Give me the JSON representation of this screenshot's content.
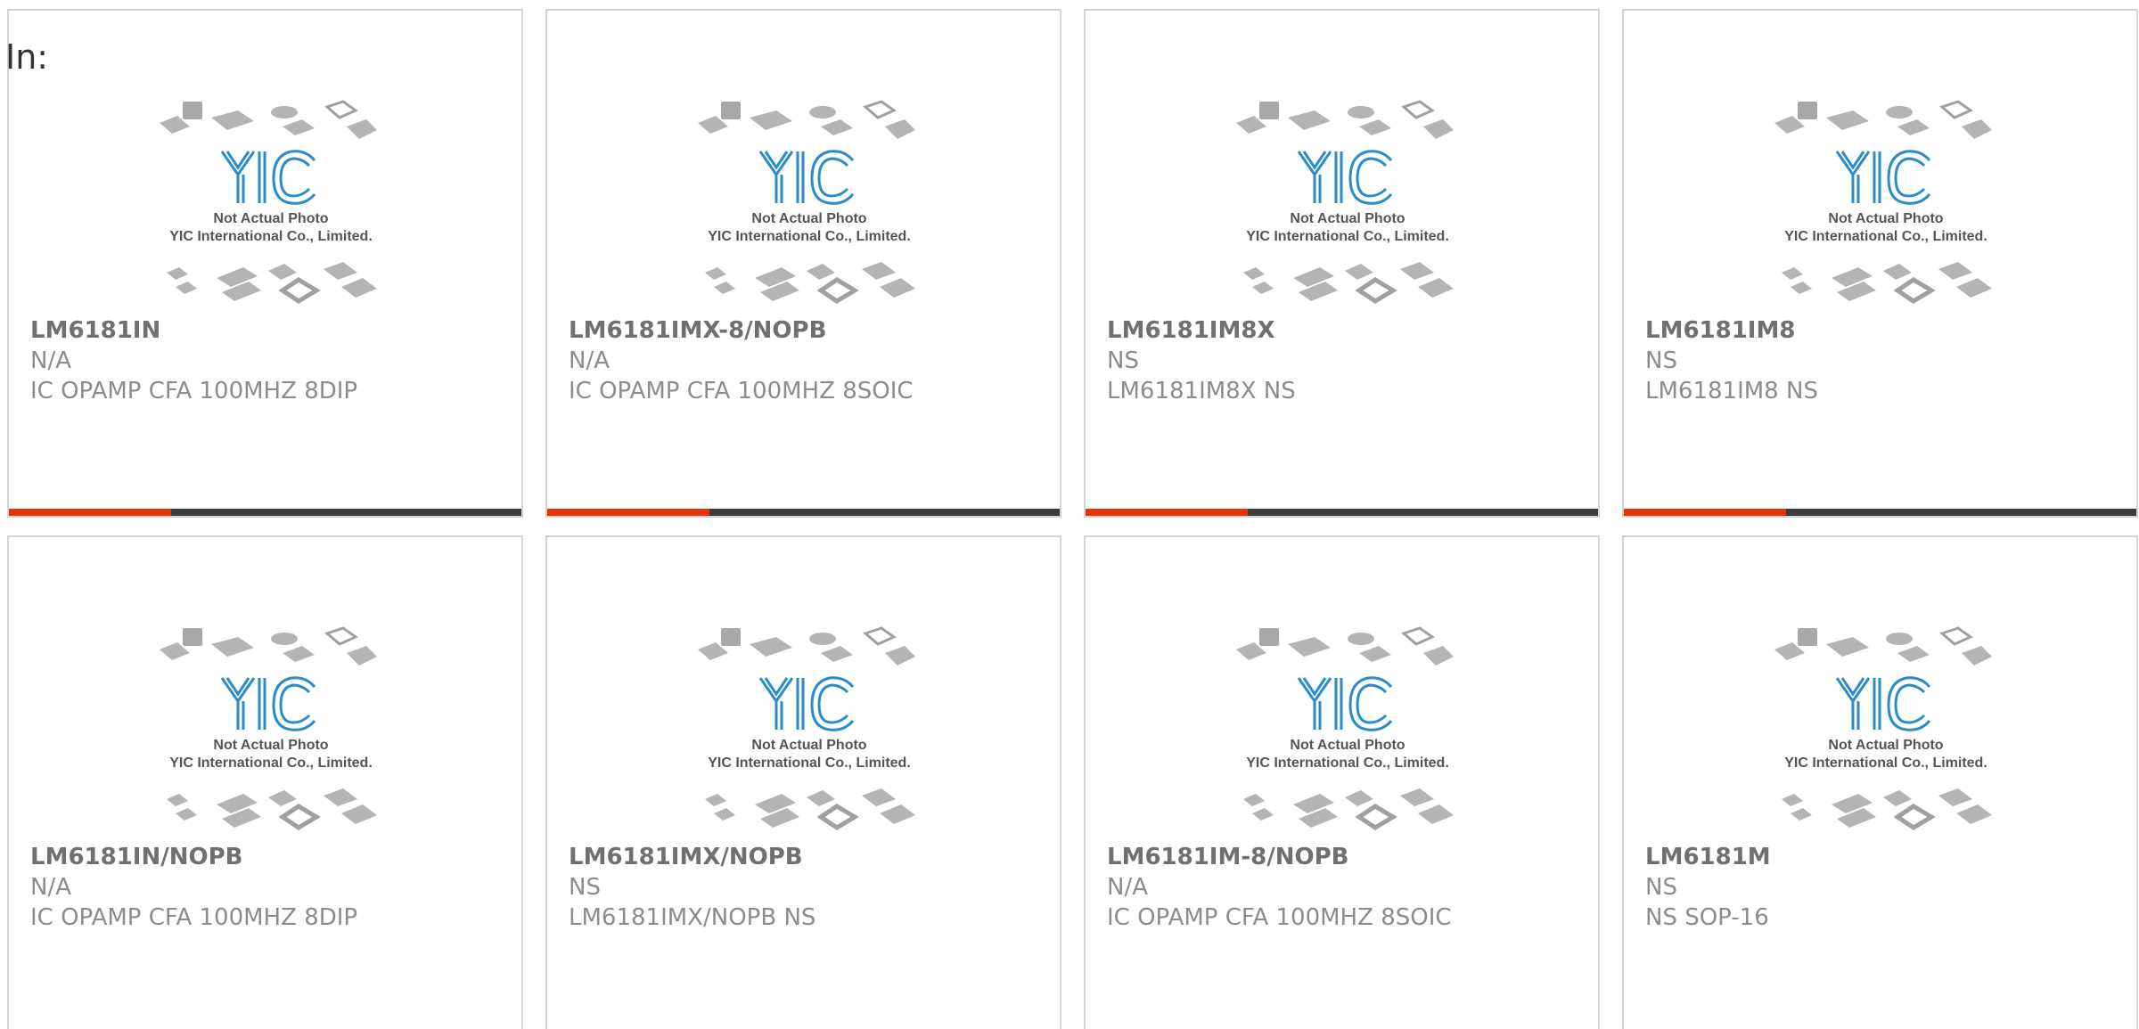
{
  "search_prefix": "In:",
  "placeholder_image": {
    "logo_text": "YIC",
    "line1": "Not Actual Photo",
    "line2": "YIC International Co., Limited."
  },
  "colors": {
    "accent": "#e8320a",
    "bar": "#3c3c3c",
    "logo_blue": "#2a8cc8",
    "border": "#d4d4d4"
  },
  "products": [
    {
      "part": "LM6181IN",
      "manufacturer": "N/A",
      "description": "IC OPAMP CFA 100MHZ 8DIP"
    },
    {
      "part": "LM6181IMX-8/NOPB",
      "manufacturer": "N/A",
      "description": "IC OPAMP CFA 100MHZ 8SOIC"
    },
    {
      "part": "LM6181IM8X",
      "manufacturer": "NS",
      "description": "LM6181IM8X NS"
    },
    {
      "part": "LM6181IM8",
      "manufacturer": "NS",
      "description": "LM6181IM8 NS"
    },
    {
      "part": "LM6181IN/NOPB",
      "manufacturer": "N/A",
      "description": "IC OPAMP CFA 100MHZ 8DIP"
    },
    {
      "part": "LM6181IMX/NOPB",
      "manufacturer": "NS",
      "description": "LM6181IMX/NOPB NS"
    },
    {
      "part": "LM6181IM-8/NOPB",
      "manufacturer": "N/A",
      "description": "IC OPAMP CFA 100MHZ 8SOIC"
    },
    {
      "part": "LM6181M",
      "manufacturer": "NS",
      "description": "NS SOP-16"
    }
  ]
}
